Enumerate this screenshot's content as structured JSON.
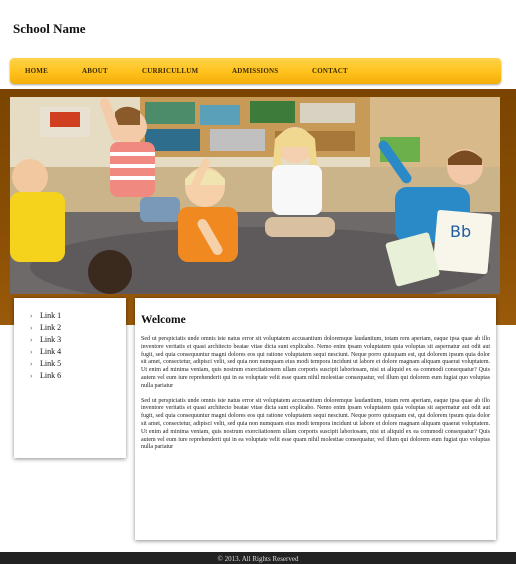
{
  "site": {
    "title": "School Name"
  },
  "nav": {
    "items": [
      "HOME",
      "ABOUT",
      "CURRICULLUM",
      "ADMISSIONS",
      "CONTACT"
    ]
  },
  "sidebar": {
    "links": [
      "Link 1",
      "Link 2",
      "Link 3",
      "Link 4",
      "Link 5",
      "Link 6"
    ]
  },
  "main": {
    "heading": "Welcome",
    "paragraphs": [
      "Sed ut perspiciatis unde omnis iste natus error sit voluptatem accusantium doloremque laudantium, totam rem aperiam, eaque ipsa quae ab illo inventore veritatis et quasi architecto beatae vitae dicta sunt explicabo. Nemo enim ipsam voluptatem quia voluptas sit aspernatur aut odit aut fugit, sed quia consequuntur magni dolores eos qui ratione voluptatem sequi nesciunt. Neque porro quisquam est, qui dolorem ipsum quia dolor sit amet, consectetur, adipisci velit, sed quia non numquam eius modi tempora incidunt ut labore et dolore magnam aliquam quaerat voluptatem. Ut enim ad minima veniam, quis nostrum exercitationem ullam corporis suscipit laboriosam, nisi ut aliquid ex ea commodi consequatur? Quis autem vel eum iure reprehenderit qui in ea voluptate velit esse quam nihil molestiae consequatur, vel illum qui dolorem eum fugiat quo voluptas nulla pariatur",
      "Sed ut perspiciatis unde omnis iste natus error sit voluptatem accusantium doloremque laudantium, totam rem aperiam, eaque ipsa quae ab illo inventore veritatis et quasi architecto beatae vitae dicta sunt explicabo. Nemo enim ipsam voluptatem quia voluptas sit aspernatur aut odit aut fugit, sed quia consequuntur magni dolores eos qui ratione voluptatem sequi nesciunt. Neque porro quisquam est, qui dolorem ipsum quia dolor sit amet, consectetur, adipisci velit, sed quia non numquam eius modi tempora incidunt ut labore et dolore magnam aliquam quaerat voluptatem. Ut enim ad minima veniam, quis nostrum exercitationem ullam corporis suscipit laboriosam, nisi ut aliquid ex ea commodi consequatur? Quis autem vel eum iure reprehenderit qui in ea voluptate velit esse quam nihil molestiae consequatur, vel illum qui dolorem eum fugiat quo voluptas nulla pariatur"
    ]
  },
  "footer": {
    "text": "© 2013. All Rights Reserved"
  },
  "colors": {
    "nav_bar": "#ffc11c",
    "band": "#8a4f05",
    "footer": "#222222"
  }
}
